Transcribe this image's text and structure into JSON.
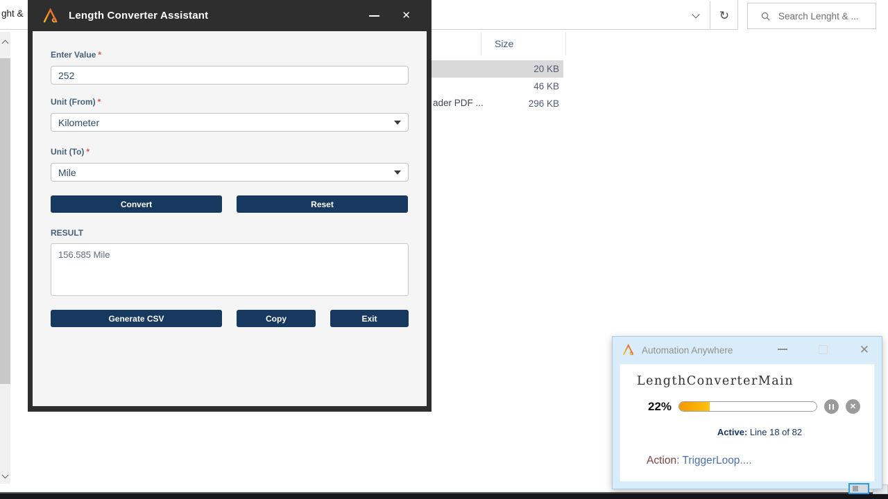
{
  "explorer": {
    "address_fragment": "ght &",
    "search": {
      "icon": "magnifier-icon",
      "text": "Search Lenght & ..."
    },
    "size_header": "Size",
    "files": [
      {
        "name": "",
        "size": "20 KB",
        "selected": true
      },
      {
        "name": "",
        "size": "46 KB",
        "selected": false
      },
      {
        "name": "ader PDF ...",
        "size": "296 KB",
        "selected": false
      }
    ]
  },
  "dialog": {
    "title": "Length Converter Assistant",
    "close_glyph": "✕",
    "enter_value_label": "Enter Value",
    "required_mark": "*",
    "enter_value": "252",
    "unit_from_label": "Unit (From)",
    "unit_from_value": "Kilometer",
    "unit_to_label": "Unit (To)",
    "unit_to_value": "Mile",
    "convert_label": "Convert",
    "reset_label": "Reset",
    "result_label": "RESULT",
    "result_value": "156.585 Mile",
    "generate_csv_label": "Generate CSV",
    "copy_label": "Copy",
    "exit_label": "Exit"
  },
  "progress": {
    "title": "Automation Anywhere",
    "close_glyph": "✕",
    "bot_name": "LengthConverterMain",
    "percent_label": "22%",
    "percent_value": 22,
    "stop_glyph": "✕",
    "active_label": "Active:",
    "active_value": " Line 18 of 82",
    "action_label": "Action",
    "action_value": ": TriggerLoop...."
  },
  "glyphs": {
    "refresh": "↻"
  },
  "colors": {
    "accent_navy": "#17395f",
    "titlebar_dark": "#2e2e2e",
    "selection_gray": "#d9d9d9",
    "required_red": "#d9534f",
    "progress_window_blue": "#d9ecf9",
    "progress_fill_start": "#f29900",
    "progress_fill_end": "#ffc20e",
    "active_text_navy": "#16355c",
    "action_label_maroon": "#7d4045",
    "action_value_blue": "#4a6fb0"
  }
}
